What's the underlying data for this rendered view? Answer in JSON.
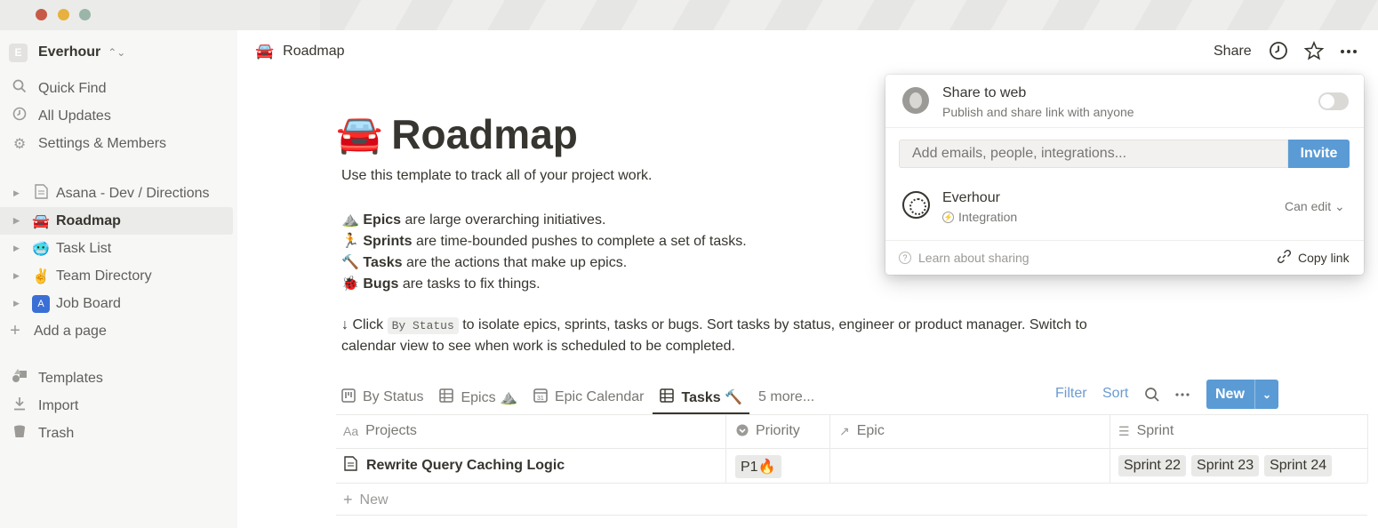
{
  "window": {
    "traffic_lights": [
      "close",
      "minimize",
      "zoom"
    ]
  },
  "sidebar": {
    "workspace": {
      "initial": "E",
      "name": "Everhour"
    },
    "nav": [
      {
        "label": "Quick Find",
        "icon": "search-icon"
      },
      {
        "label": "All Updates",
        "icon": "clock-icon"
      },
      {
        "label": "Settings & Members",
        "icon": "gear-icon"
      }
    ],
    "pages": [
      {
        "label": "Asana - Dev / Directions",
        "icon": "document-icon"
      },
      {
        "label": "Roadmap",
        "icon": "🚘",
        "active": true
      },
      {
        "label": "Task List",
        "icon": "🥶"
      },
      {
        "label": "Team Directory",
        "icon": "✌️"
      },
      {
        "label": "Job Board",
        "icon": "A"
      }
    ],
    "add_page": "Add a page",
    "bottom": [
      {
        "label": "Templates",
        "icon": "templates-icon"
      },
      {
        "label": "Import",
        "icon": "import-icon"
      },
      {
        "label": "Trash",
        "icon": "trash-icon"
      }
    ]
  },
  "topbar": {
    "breadcrumb": {
      "emoji": "🚘",
      "label": "Roadmap"
    },
    "share_label": "Share"
  },
  "page": {
    "emoji": "🚘",
    "title": "Roadmap",
    "intro": "Use this template to track all of your project work.",
    "bullets": [
      {
        "emoji": "⛰️",
        "bold": "Epics",
        "rest": " are large overarching initiatives."
      },
      {
        "emoji": "🏃",
        "bold": "Sprints",
        "rest": " are time-bounded pushes to complete a set of tasks."
      },
      {
        "emoji": "🔨",
        "bold": "Tasks",
        "rest": " are the actions that make up epics."
      },
      {
        "emoji": "🐞",
        "bold": "Bugs",
        "rest": " are tasks to fix things."
      }
    ],
    "click_prefix": "↓ Click",
    "click_code": "By Status",
    "click_rest": "to isolate epics, sprints, tasks or bugs. Sort tasks by status, engineer or product manager. Switch to",
    "click_line2": "calendar view to see when work is scheduled to be completed."
  },
  "views": {
    "tabs": [
      {
        "label": "By Status",
        "icon": "board-icon"
      },
      {
        "label": "Epics ⛰️",
        "icon": "table-icon"
      },
      {
        "label": "Epic Calendar",
        "icon": "calendar-icon"
      },
      {
        "label": "Tasks 🔨",
        "icon": "table-icon",
        "active": true
      }
    ],
    "more": "5 more...",
    "filter": "Filter",
    "sort": "Sort",
    "new_label": "New"
  },
  "table": {
    "headers": [
      {
        "label": "Projects",
        "icon": "Aa"
      },
      {
        "label": "Priority",
        "icon": "select-icon"
      },
      {
        "label": "Epic",
        "icon": "relation-icon"
      },
      {
        "label": "Sprint",
        "icon": "list-icon"
      }
    ],
    "rows": [
      {
        "project": "Rewrite Query Caching Logic",
        "priority": "P1🔥",
        "epic": "",
        "sprints": [
          "Sprint 22",
          "Sprint 23",
          "Sprint 24"
        ]
      }
    ],
    "new_row": "New"
  },
  "share_popover": {
    "web_title": "Share to web",
    "web_subtitle": "Publish and share link with anyone",
    "web_enabled": false,
    "invite_placeholder": "Add emails, people, integrations...",
    "invite_label": "Invite",
    "member_name": "Everhour",
    "member_type": "Integration",
    "member_permission": "Can edit",
    "learn_label": "Learn about sharing",
    "copy_label": "Copy link"
  },
  "colors": {
    "accent": "#5b9bd5",
    "link": "#6b9bd2",
    "sidebar_bg": "#f7f7f5"
  }
}
